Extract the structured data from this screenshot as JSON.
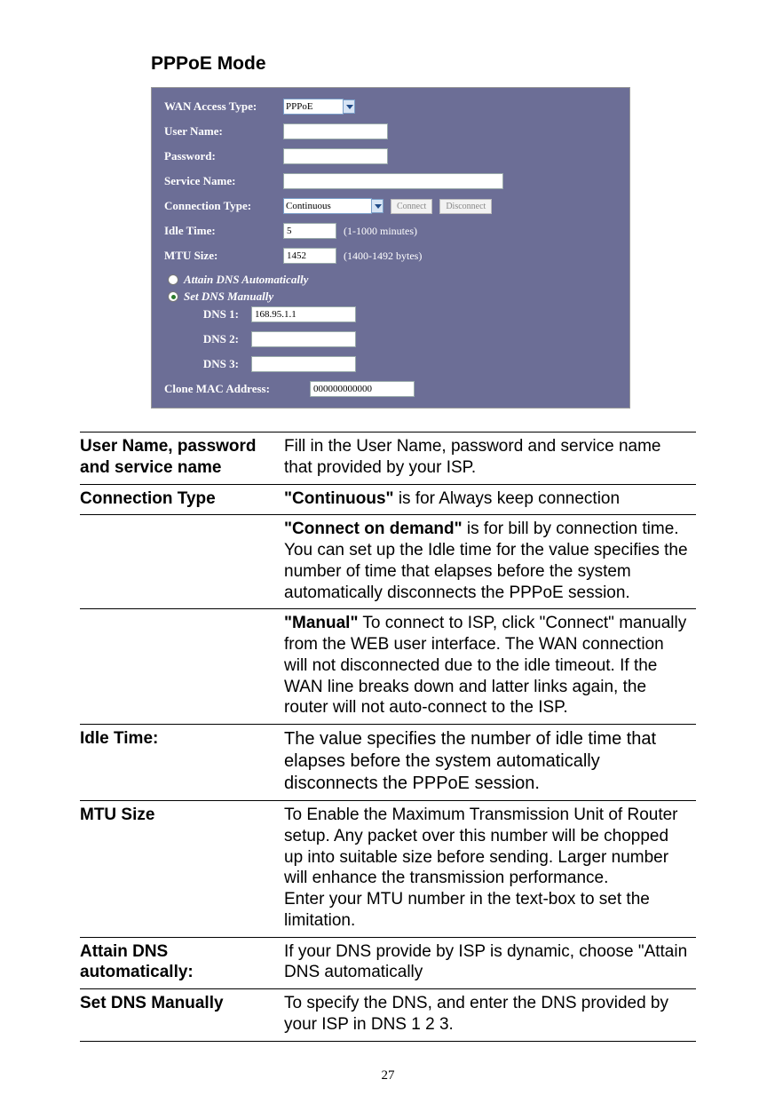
{
  "title": "PPPoE Mode",
  "router": {
    "wan_access_label": "WAN Access Type:",
    "wan_access_value": "PPPoE",
    "user_name_label": "User Name:",
    "user_name_value": "",
    "password_label": "Password:",
    "password_value": "",
    "service_name_label": "Service Name:",
    "service_name_value": "",
    "connection_type_label": "Connection Type:",
    "connection_type_value": "Continuous",
    "connect_btn": "Connect",
    "disconnect_btn": "Disconnect",
    "idle_time_label": "Idle Time:",
    "idle_time_value": "5",
    "idle_time_hint": "(1-1000 minutes)",
    "mtu_label": "MTU Size:",
    "mtu_value": "1452",
    "mtu_hint": "(1400-1492 bytes)",
    "attain_dns_label": "Attain DNS Automatically",
    "set_dns_label": "Set DNS Manually",
    "dns1_label": "DNS 1:",
    "dns1_value": "168.95.1.1",
    "dns2_label": "DNS 2:",
    "dns2_value": "",
    "dns3_label": "DNS 3:",
    "dns3_value": "",
    "clone_mac_label": "Clone MAC Address:",
    "clone_mac_value": "000000000000"
  },
  "table": {
    "row1_label": "User Name, password and service name",
    "row1_desc": "Fill in the User Name, password and service name that provided by your ISP.",
    "row2_label": "Connection Type",
    "row2_desc_bold": "\"Continuous\"",
    "row2_desc_rest": " is for Always keep connection",
    "row3_bold": "\"Connect on demand\"",
    "row3_rest": " is for bill by connection time. You can set up the Idle time for the value specifies the number of time that elapses before the system automatically disconnects the PPPoE session.",
    "row4_bold": "\"Manual\"",
    "row4_rest": " To connect to ISP, click \"Connect\" manually from the WEB user interface. The WAN connection will not disconnected due to the idle timeout. If the WAN line breaks down and latter links again, the router will not auto-connect to the ISP.",
    "row5_label": "Idle Time:",
    "row5_desc": "The value specifies the number of idle time that elapses before the system automatically disconnects the PPPoE session.",
    "row6_label": "MTU Size",
    "row6_desc": "To Enable the Maximum Transmission Unit of Router setup. Any packet over this number will be chopped up into suitable size before sending. Larger number will enhance the transmission performance.\nEnter your MTU number in the text-box to set the limitation.",
    "row7_label": "Attain DNS automatically:",
    "row7_desc": "If your DNS provide by ISP is dynamic, choose \"Attain DNS automatically",
    "row8_label": "Set DNS Manually",
    "row8_desc": "To specify the DNS, and enter the DNS provided by your ISP in DNS 1 2 3."
  },
  "pagenum": "27"
}
